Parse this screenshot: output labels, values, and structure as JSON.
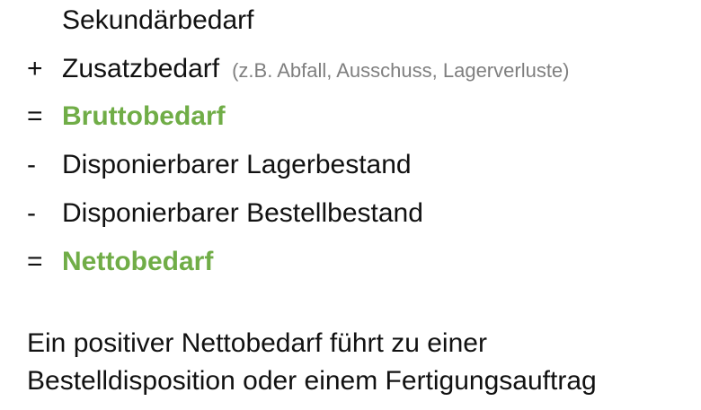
{
  "calculation": {
    "rows": [
      {
        "operator": "",
        "term": "Sekundärbedarf",
        "note": "",
        "highlight": false
      },
      {
        "operator": "+",
        "term": "Zusatzbedarf",
        "note": "(z.B. Abfall, Ausschuss, Lagerverluste)",
        "highlight": false
      },
      {
        "operator": "=",
        "term": "Bruttobedarf",
        "note": "",
        "highlight": true
      },
      {
        "operator": "-",
        "term": "Disponierbarer Lagerbestand",
        "note": "",
        "highlight": false
      },
      {
        "operator": "-",
        "term": "Disponierbarer Bestellbestand",
        "note": "",
        "highlight": false
      },
      {
        "operator": "=",
        "term": "Nettobedarf",
        "note": "",
        "highlight": true
      }
    ]
  },
  "conclusion": {
    "line1": "Ein positiver Nettobedarf führt zu einer",
    "line2": "Bestelldisposition oder einem Fertigungsauftrag"
  },
  "colors": {
    "highlight": "#70ad47",
    "note": "#7f7f7f",
    "text": "#111111"
  }
}
